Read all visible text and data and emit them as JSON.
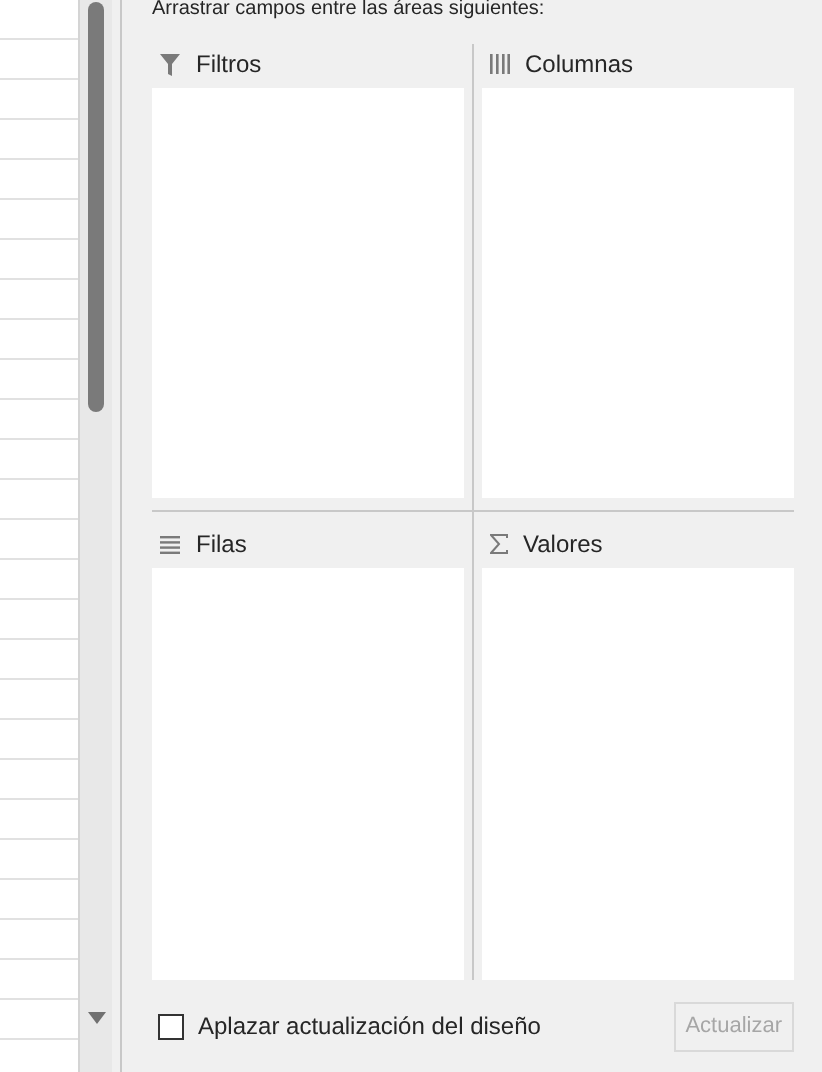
{
  "instruction": "Arrastrar campos entre las áreas siguientes:",
  "areas": [
    {
      "kind": "filters",
      "label": "Filtros"
    },
    {
      "kind": "columns",
      "label": "Columnas"
    },
    {
      "kind": "rows",
      "label": "Filas"
    },
    {
      "kind": "values",
      "label": "Valores"
    }
  ],
  "defer_update": {
    "label": "Aplazar actualización del diseño",
    "checked": false
  },
  "update_button": {
    "label": "Actualizar",
    "disabled": true
  }
}
